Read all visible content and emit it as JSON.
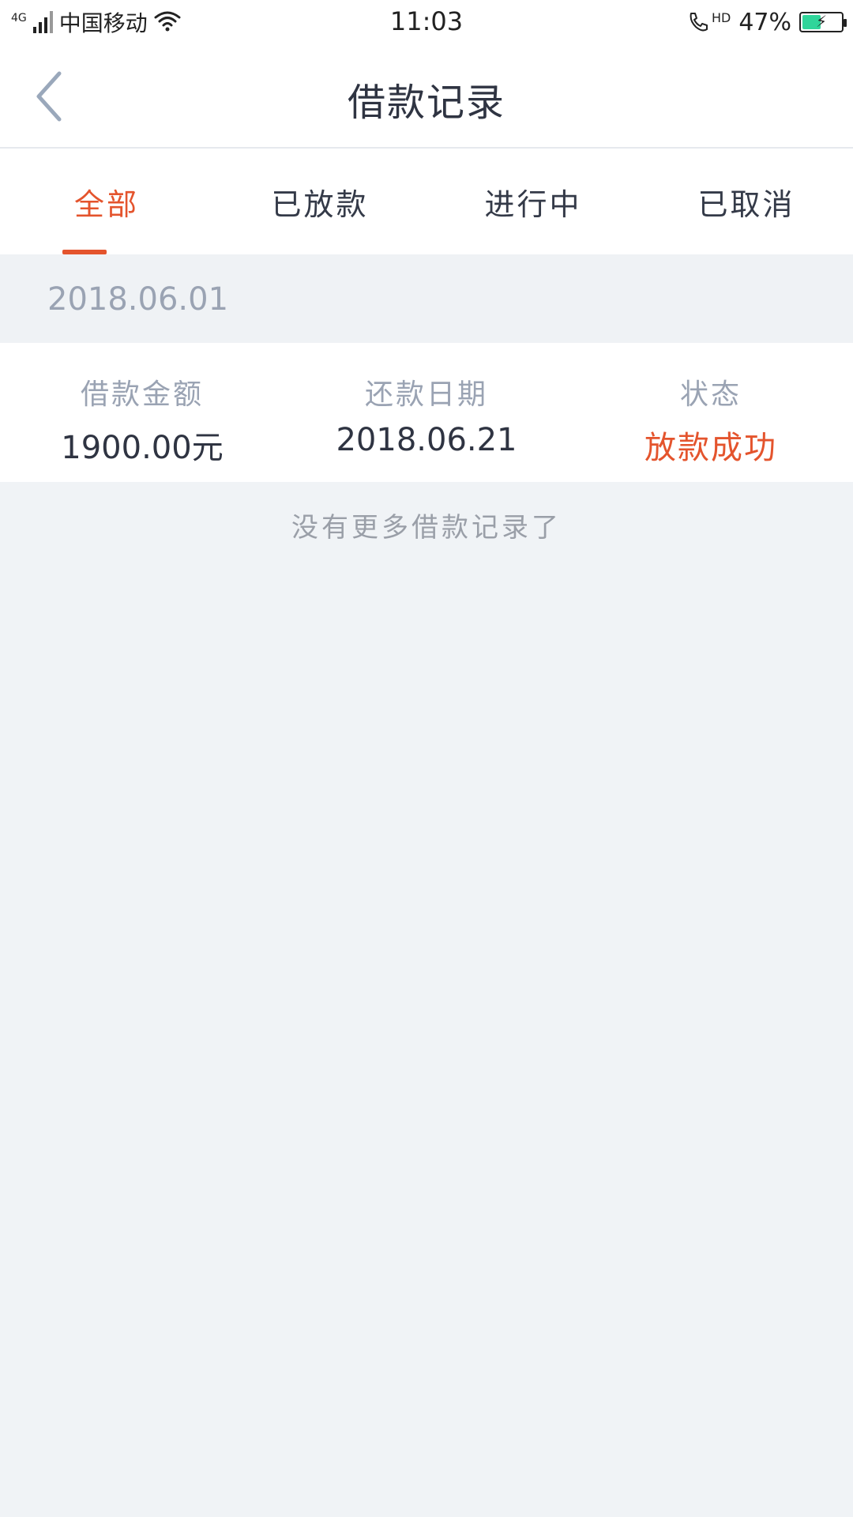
{
  "status_bar": {
    "network": "4G",
    "carrier": "中国移动",
    "time": "11:03",
    "call_tag": "HD",
    "battery_percent": "47%",
    "battery_level": 0.47,
    "battery_color": "#2fd59a"
  },
  "header": {
    "title": "借款记录",
    "back_icon": "chevron-left-icon"
  },
  "tabs": [
    {
      "label": "全部",
      "active": true
    },
    {
      "label": "已放款",
      "active": false
    },
    {
      "label": "进行中",
      "active": false
    },
    {
      "label": "已取消",
      "active": false
    }
  ],
  "records": [
    {
      "date": "2018.06.01",
      "amount_label": "借款金额",
      "amount_value": "1900.00元",
      "repay_label": "还款日期",
      "repay_value": "2018.06.21",
      "status_label": "状态",
      "status_value": "放款成功"
    }
  ],
  "footer": {
    "no_more_text": "没有更多借款记录了"
  },
  "colors": {
    "accent": "#e4542d",
    "background": "#f0f3f6",
    "muted_text": "#9aa3b3"
  }
}
